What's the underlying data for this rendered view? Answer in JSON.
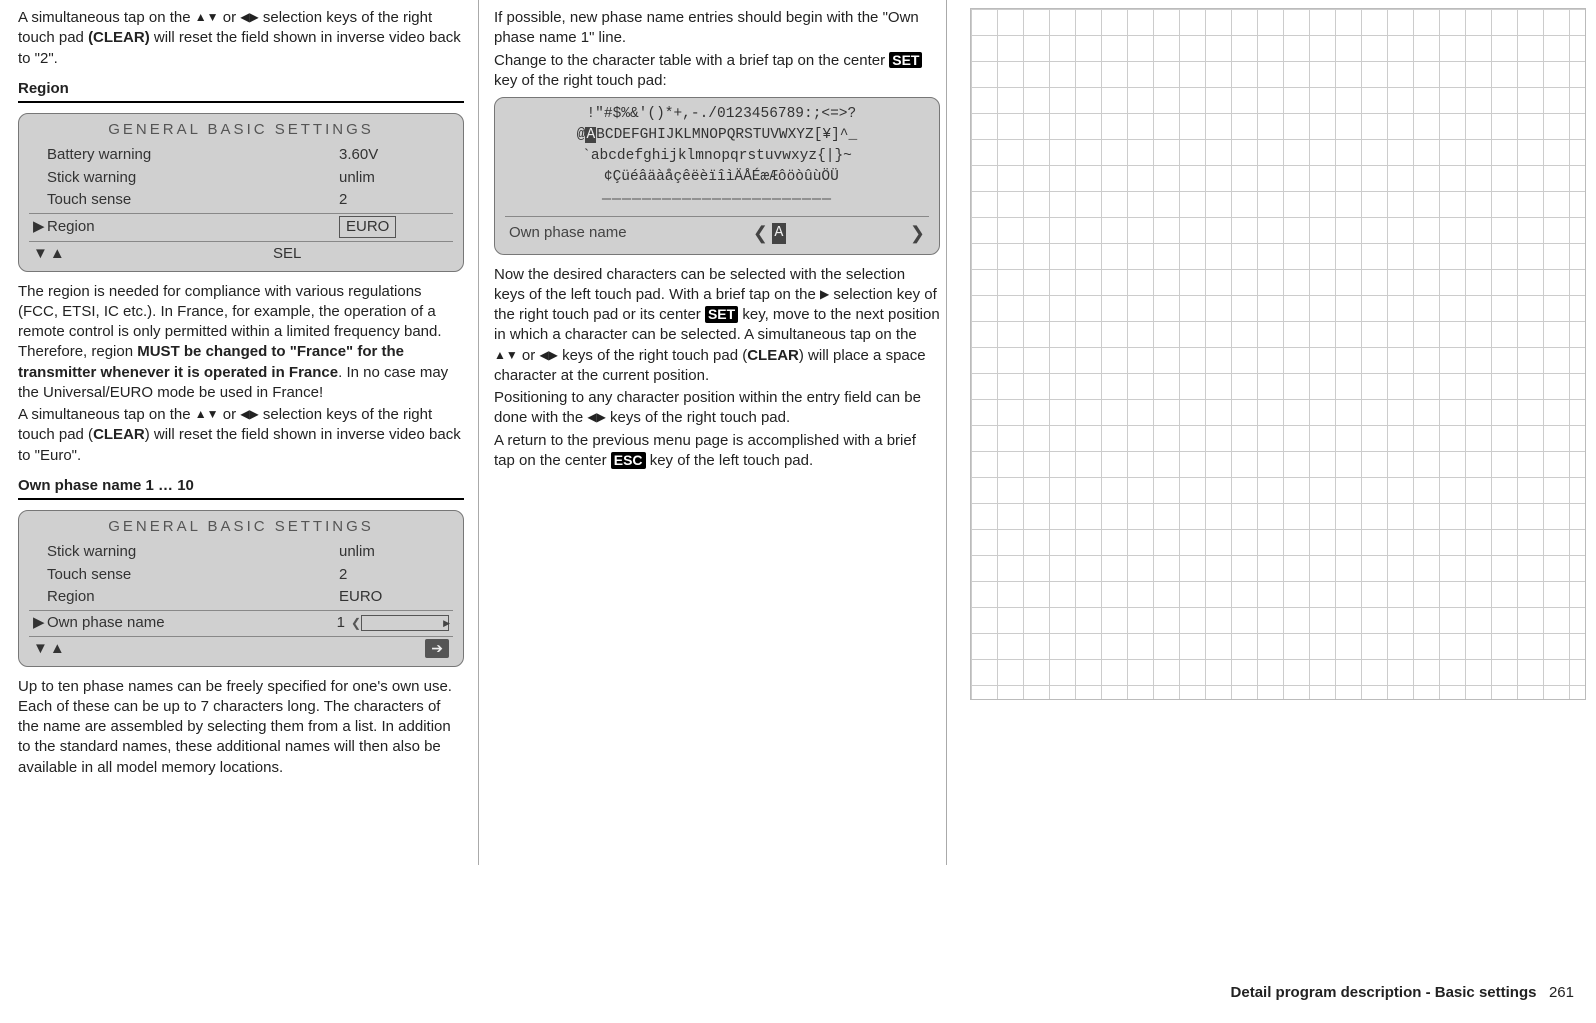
{
  "col1": {
    "p1_a": "A simultaneous tap on the ",
    "p1_arrows1": "▲▼",
    "p1_or": " or ",
    "p1_arrows2": "◀▶",
    "p1_b": " selection keys of the right touch pad ",
    "p1_clear": "(CLEAR)",
    "p1_c": " will reset the field shown in inverse video back to \"2\".",
    "h_region": "Region",
    "lcd1": {
      "title": "GENERAL BASIC SETTINGS",
      "rows": [
        {
          "label": "Battery warning",
          "value": "3.60V"
        },
        {
          "label": "Stick warning",
          "value": "unlim"
        },
        {
          "label": "Touch sense",
          "value": "2"
        }
      ],
      "sel_label": "Region",
      "sel_value": "EURO",
      "foot_mid": "SEL"
    },
    "p2_a": "The region is needed for compliance with various regulations (FCC, ETSI, IC etc.). In France, for example, the operation of a remote control is only permitted within a limited frequency band. Therefore, region ",
    "p2_bold": "MUST be changed to \"France\" for the transmitter whenever it is operated in France",
    "p2_b": ". In no case may the Universal/EURO mode be used in France!",
    "p3_a": "A simultaneous tap on the ",
    "p3_arrows1": "▲▼",
    "p3_or": " or ",
    "p3_arrows2": "◀▶",
    "p3_b": " selection keys of the right touch pad (",
    "p3_clear": "CLEAR",
    "p3_c": ") will reset the field shown in inverse video back to \"Euro\".",
    "h_own": "Own phase name 1 … 10",
    "lcd2": {
      "title": "GENERAL BASIC SETTINGS",
      "rows": [
        {
          "label": "Stick warning",
          "value": "unlim"
        },
        {
          "label": "Touch sense",
          "value": "2"
        },
        {
          "label": "Region",
          "value": "EURO"
        }
      ],
      "sel_label": "Own phase name",
      "sel_num": "1"
    },
    "p4": "Up to ten phase names can be freely specified for one's own use. Each of these can be up to 7 characters long. The characters of the name are assembled by selecting them from a list. In addition to the standard names, these additional names will then also be available in all model memory locations."
  },
  "col2": {
    "p1": "If possible, new phase name entries should begin with the \"Own phase name 1\" line.",
    "p2_a": "Change to the character table with a brief tap on the center ",
    "p2_set": "SET",
    "p2_b": " key of the right touch pad:",
    "chars": {
      "l1": " !\"#$%&'()*+,-./0123456789:;<=>?",
      "l2_a": "@",
      "l2_hl": "A",
      "l2_b": "BCDEFGHIJKLMNOPQRSTUVWXYZ[¥]^_",
      "l3": "`abcdefghijklmnopqrstuvwxyz{|}~",
      "l4": " ¢ÇüéâäàåçêëèïîìÄÅÉæÆôöòûùÖÜ",
      "bottom_label": "Own phase name",
      "cursor": "A"
    },
    "p3_a": "Now the desired characters can be selected with the selection keys of the left touch pad. With a brief tap on the ",
    "p3_arr": "▶",
    "p3_b": " selection key of the right touch pad or its center ",
    "p3_set": "SET",
    "p3_c": " key, move to the next position in which a character can be selected. A simultaneous tap on the ",
    "p3_arrows1": "▲▼",
    "p3_or": " or ",
    "p3_arrows2": "◀▶",
    "p3_d": " keys of the right touch pad (",
    "p3_clear": "CLEAR",
    "p3_e": ") will place a space character at the current position.",
    "p4_a": "Positioning to any character position within the entry field can be done with the ",
    "p4_arrows": "◀▶",
    "p4_b": " keys of the right touch pad.",
    "p5_a": "A return to the previous menu page is accomplished with a brief tap on the center ",
    "p5_esc": "ESC",
    "p5_b": " key of the left touch pad."
  },
  "footer": {
    "title": "Detail program description - Basic settings",
    "page": "261"
  }
}
